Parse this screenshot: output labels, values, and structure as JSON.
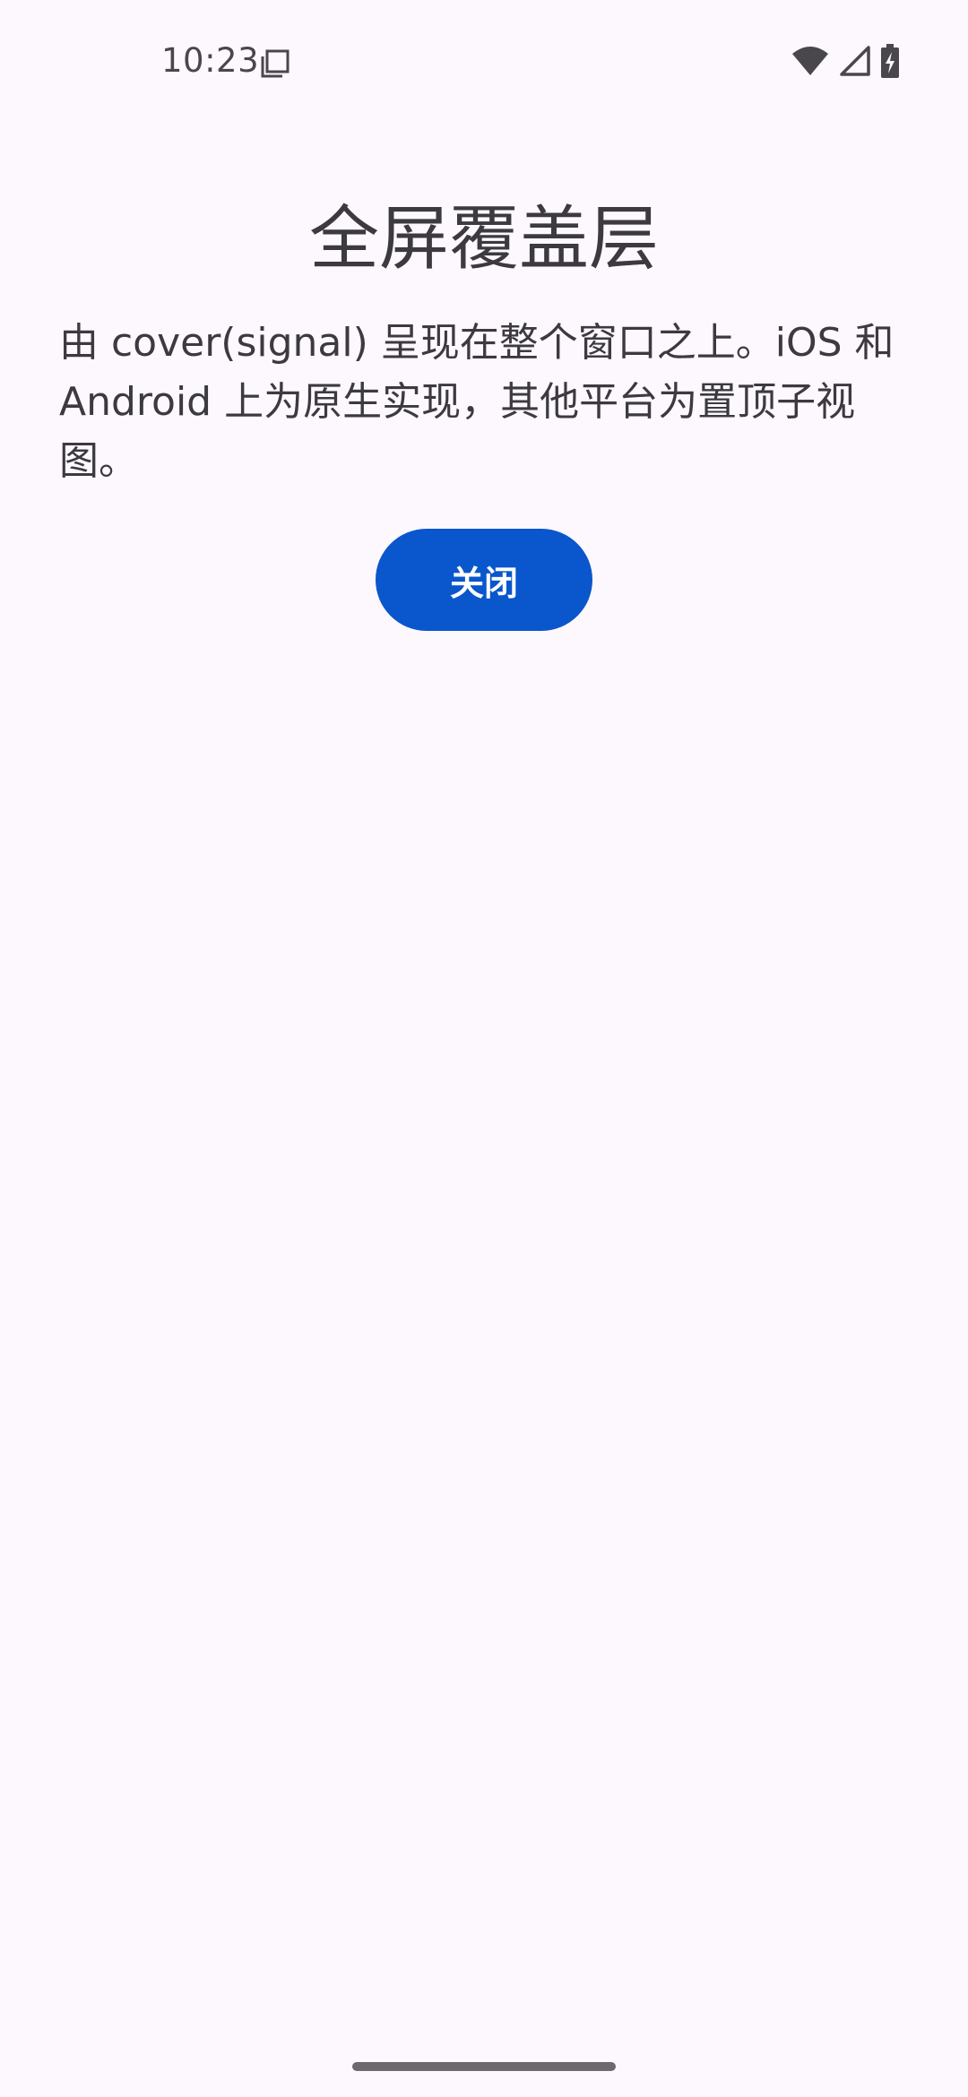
{
  "status_bar": {
    "time": "10:23",
    "icons": [
      "notification-icon",
      "wifi-icon",
      "cellular-signal-icon",
      "battery-charging-icon"
    ]
  },
  "overlay": {
    "title": "全屏覆盖层",
    "description": "由 cover(signal) 呈现在整个窗口之上。iOS 和 Android 上为原生实现，其他平台为置顶子视图。",
    "close_label": "关闭"
  },
  "colors": {
    "background": "#fdf8fd",
    "text": "#3d3a3f",
    "accent": "#0a56cc",
    "button_text": "#ffffff"
  }
}
